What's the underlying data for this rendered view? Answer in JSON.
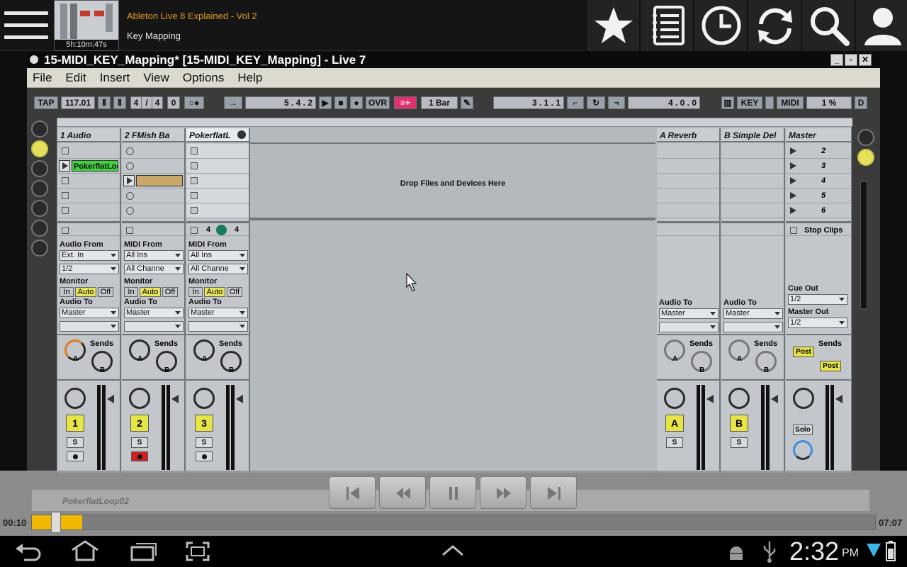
{
  "app": {
    "course_title": "Ableton Live 8 Explained - Vol 2",
    "lesson_title": "Key Mapping",
    "thumb_duration": "5h:10m:47s",
    "toolbar_icons": [
      "star-icon",
      "list-icon",
      "clock-icon",
      "refresh-icon",
      "search-icon",
      "user-icon"
    ]
  },
  "window": {
    "title": "15-MIDI_KEY_Mapping*  [15-MIDI_KEY_Mapping] - Live 7",
    "menu": [
      "File",
      "Edit",
      "Insert",
      "View",
      "Options",
      "Help"
    ]
  },
  "transport": {
    "tap": "TAP",
    "tempo": "117.01",
    "signature_num": "4",
    "signature_slash": "/",
    "signature_den": "4",
    "metro": "0",
    "position": "5 .   4 .   2",
    "ovr": "OVR",
    "quantize": "1 Bar",
    "loop_start": "3 .   1 .   1",
    "loop_length": "4 .   0 .   0",
    "key": "KEY",
    "midi": "MIDI",
    "cpu": "1 %",
    "d": "D"
  },
  "tracks": [
    {
      "name": "1 Audio",
      "clip": "PokerflatLoo",
      "from_label": "Audio From",
      "from": "Ext. In",
      "channel": "1/2",
      "to": "Master",
      "number": "1"
    },
    {
      "name": "2 FMish Ba",
      "from_label": "MIDI From",
      "from": "All Ins",
      "channel": "All Channe",
      "to": "Master",
      "number": "2"
    },
    {
      "name": "PokerflatL",
      "from_label": "MIDI From",
      "from": "All Ins",
      "channel": "All Channe",
      "to": "Master",
      "number": "3",
      "extra1": "4",
      "extra2": "4"
    }
  ],
  "labels": {
    "monitor": "Monitor",
    "audio_to": "Audio To",
    "mon_in": "In",
    "mon_auto": "Auto",
    "mon_off": "Off",
    "sends": "Sends",
    "a": "A",
    "b": "B",
    "s": "S",
    "drop": "Drop Files and Devices Here"
  },
  "returns": [
    {
      "name": "A Reverb",
      "letter": "A",
      "to": "Master"
    },
    {
      "name": "B Simple Del",
      "letter": "B",
      "to": "Master"
    }
  ],
  "master": {
    "name": "Master",
    "scenes": [
      "2",
      "3",
      "4",
      "5",
      "6"
    ],
    "stop_clips": "Stop Clips",
    "cue_out_label": "Cue Out",
    "cue_out": "1/2",
    "master_out_label": "Master Out",
    "master_out": "1/2",
    "post1": "Post",
    "post2": "Post",
    "solo": "Solo"
  },
  "player": {
    "current_time": "00:10",
    "end_time": "07:07",
    "progress": 0.06,
    "underlay_clip": "PokerflatLoop02"
  },
  "system": {
    "clock": "2:32",
    "ampm": "PM"
  },
  "colors": {
    "accent_orange": "#e69a1f",
    "clip_green": "#3fd13f",
    "clip_tan": "#c9a66a",
    "track_yellow": "#e6e545"
  }
}
